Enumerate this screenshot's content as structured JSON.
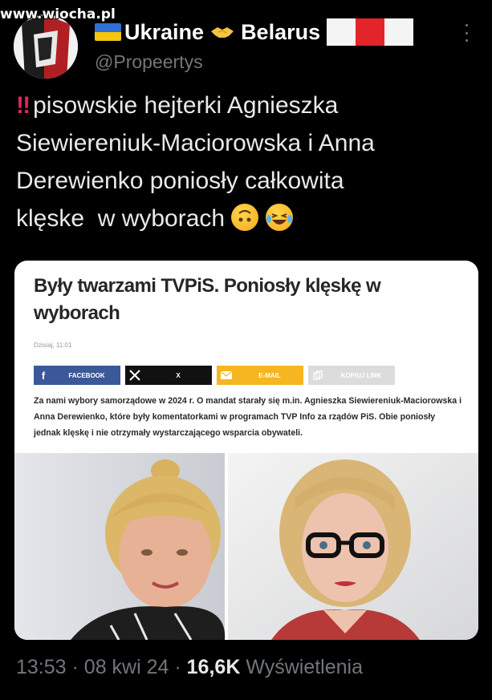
{
  "watermark": "www.wiocha.pl",
  "header": {
    "name_part1": "Ukraine",
    "name_part2": "Belarus",
    "handle": "@Propeertys"
  },
  "tweet": {
    "line1": "pisowskie hejterki Agnieszka",
    "line2": "Siewiereniuk-Maciorowska i Anna",
    "line3": "Derewienko poniosły całkowita",
    "line4": "klęske  w wyborach"
  },
  "article": {
    "title": "Były twarzami TVPiS. Poniosły klęskę w wyborach",
    "date": "Dzisiaj, 11:01",
    "share": {
      "facebook": "FACEBOOK",
      "x": "X",
      "email": "E-MAIL",
      "copy": "KOPIUJ LINK"
    },
    "body": "Za nami wybory samorządowe w 2024 r. O mandat starały się m.in. Agnieszka Siewiereniuk-Maciorowska i Anna Derewienko, które były komentatorkami w programach TVP Info za rządów PiS. Obie poniosły jednak klęskę i nie otrzymały wystarczającego wsparcia obywateli."
  },
  "footer": {
    "time": "13:53",
    "date": "08 kwi 24",
    "views_count": "16,6K",
    "views_label": "Wyświetlenia"
  },
  "colors": {
    "background": "#000000",
    "text": "#e7e9ea",
    "muted": "#71767b",
    "facebook": "#3b5998",
    "email": "#f5b621"
  },
  "icons": [
    "ukraine-flag-icon",
    "handshake-icon",
    "belarus-flag-icon",
    "more-options-icon",
    "double-exclamation-icon",
    "upside-down-face-icon",
    "laughing-tears-icon",
    "facebook-icon",
    "x-logo-icon",
    "mail-icon",
    "copy-link-icon"
  ]
}
